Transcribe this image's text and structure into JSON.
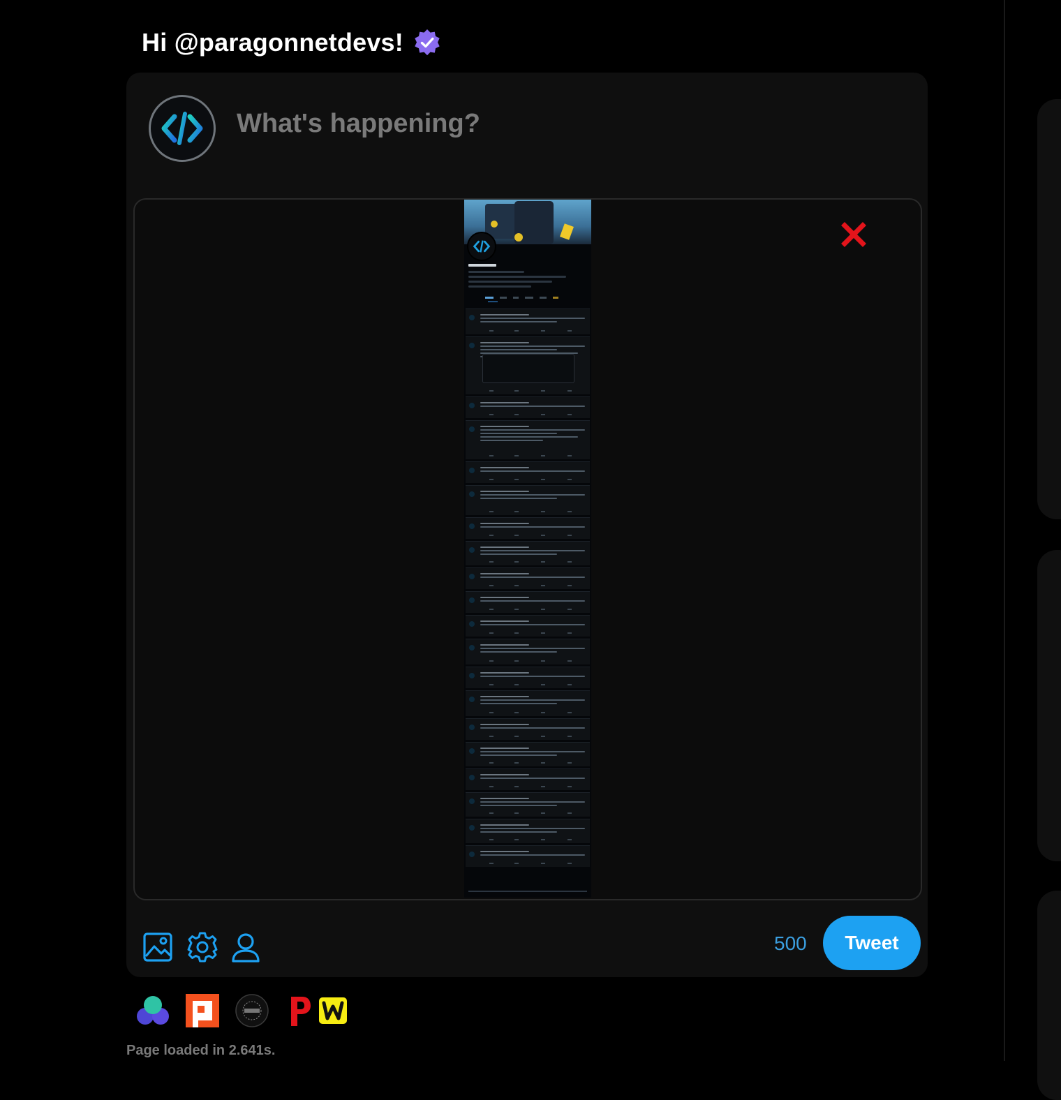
{
  "greeting": {
    "text": "Hi @paragonnetdevs!",
    "verified_icon": "verified-badge-icon"
  },
  "composer": {
    "placeholder": "What's happening?",
    "char_remaining": "500",
    "tweet_button_label": "Tweet",
    "toolbar_icons": [
      "image-icon",
      "gear-icon",
      "user-icon"
    ],
    "remove_media_icon": "close-icon"
  },
  "app_shortcuts": [
    "connect-app-icon",
    "paragon-app-icon",
    "dark-circle-app-icon",
    "red-p-app-icon",
    "w-app-icon"
  ],
  "footer": {
    "status": "Page loaded in 2.641s."
  },
  "colors": {
    "accent": "#1da1f2",
    "background": "#000000",
    "card": "#0f0f0f",
    "verified": "#8b6cf0",
    "remove": "#e3141b"
  }
}
